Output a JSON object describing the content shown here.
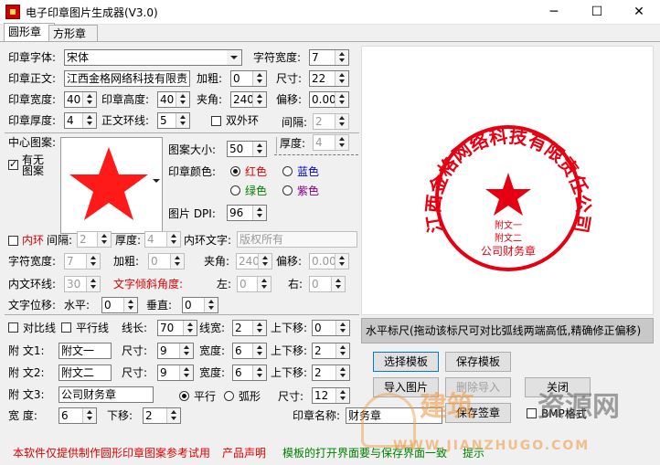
{
  "window": {
    "title": "电子印章图片生成器(V3.0)",
    "minimize": "─",
    "maximize": "☐",
    "close": "✕"
  },
  "tabs": [
    "圆形章",
    "方形章"
  ],
  "row1": {
    "font_label": "印章字体:",
    "font_value": "宋体",
    "charw_label": "字符宽度:",
    "charw_value": "7"
  },
  "row2": {
    "text_label": "印章正文:",
    "text_value": "江西金格网络科技有限责",
    "bold_label": "加粗:",
    "bold_value": "0",
    "size_label": "尺寸:",
    "size_value": "22"
  },
  "row3": {
    "width_label": "印章宽度:",
    "width_value": "40",
    "height_label": "印章高度:",
    "height_value": "40",
    "angle_label": "夹角:",
    "angle_value": "240",
    "offset_label": "偏移:",
    "offset_value": "0.000"
  },
  "row4": {
    "thick_label": "印章厚度:",
    "thick_value": "4",
    "ring_label": "正文环线:",
    "ring_value": "5",
    "double_label": "双外环",
    "gap_label": "间隔:",
    "gap_value": "2",
    "thick2_label": "厚度:",
    "thick2_value": "4"
  },
  "center": {
    "group_label": "中心图案:",
    "has_label": "有无",
    "pattern_label": "图案",
    "size_label": "图案大小:",
    "size_value": "50",
    "color_label": "印章颜色:",
    "colors": {
      "red": "红色",
      "blue": "蓝色",
      "green": "绿色",
      "purple": "紫色"
    },
    "dpi_label": "图片 DPI:",
    "dpi_value": "96"
  },
  "inner": {
    "ring_label": "内环",
    "gap_label": "间隔:",
    "gap_value": "2",
    "thick_label": "厚度:",
    "thick_value": "4",
    "text_label": "内环文字:",
    "text_value": "版权所有",
    "charw_label": "字符宽度:",
    "charw_value": "7",
    "bold_label": "加粗:",
    "bold_value": "0",
    "angle_label": "夹角:",
    "angle_value": "240",
    "offset_label": "偏移:",
    "offset_value": "0.000",
    "ring_line_label": "内文环线:",
    "ring_line_value": "30",
    "tilt_label": "文字倾斜角度:",
    "left_label": "左:",
    "left_value": "0",
    "right_label": "右:",
    "right_value": "0",
    "shift_label": "文字位移:",
    "h_label": "水平:",
    "h_value": "0",
    "v_label": "垂直:",
    "v_value": "0"
  },
  "lines": {
    "compare_label": "对比线",
    "parallel_label": "平行线",
    "length_label": "线长:",
    "length_value": "70",
    "width_label": "线宽:",
    "width_value": "2",
    "updown_label": "上下移:",
    "updown_value": "0"
  },
  "attached": [
    {
      "label": "附  文1:",
      "value": "附文一",
      "size_label": "尺寸:",
      "size_value": "9",
      "width_label": "宽度:",
      "width_value": "6",
      "ud_label": "上下移:",
      "ud_value": "2"
    },
    {
      "label": "附  文2:",
      "value": "附文二",
      "size_label": "尺寸:",
      "size_value": "9",
      "width_label": "宽度:",
      "width_value": "6",
      "ud_label": "上下移:",
      "ud_value": "2"
    }
  ],
  "attached3": {
    "label": "附  文3:",
    "value": "公司财务章",
    "flat_label": "平行",
    "arc_label": "弧形",
    "size_label": "尺寸:",
    "size_value": "12"
  },
  "bottomrow": {
    "width_label": "宽    度:",
    "width_value": "6",
    "down_label": "下移:",
    "down_value": "2",
    "name_label": "印章名称:",
    "name_value": "财务章"
  },
  "ruler_hint": "水平标尺(拖动该标尺可对比弧线两端高低,精确修正偏移)",
  "buttons": {
    "select_template": "选择模板",
    "save_template": "保存模板",
    "import_image": "导入图片",
    "delete_import": "删除导入",
    "close": "关闭",
    "save_seal": "保存签章",
    "bmp_label": "BMP格式"
  },
  "footer": {
    "disclaimer": "本软件仅提供制作圆形印章图案参考试用",
    "product_statement": "产品声明",
    "tip": "模板的打开界面要与保存界面一致",
    "hint_btn": "提示"
  },
  "seal": {
    "ring_text": "江西金格网络科技有限责任公司",
    "sub1": "附文一",
    "sub2": "附文二",
    "bottom_text": "公司财务章",
    "color": "#e60012"
  },
  "watermark": {
    "line1": "建筑",
    "line2": "资源网",
    "url": "WWW.JIANZHUGO.COM"
  }
}
